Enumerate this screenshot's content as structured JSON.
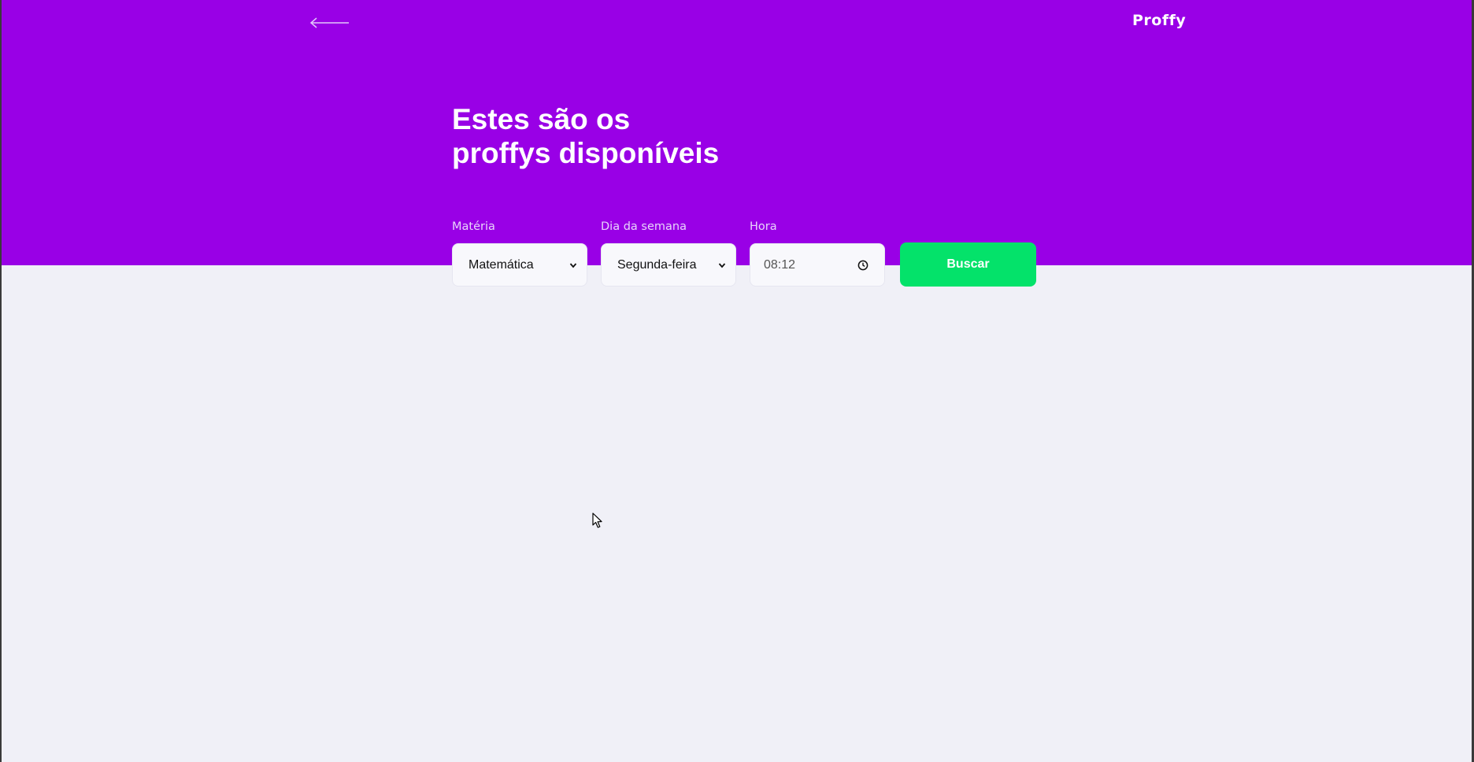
{
  "header": {
    "logo": "Proffy",
    "title_line1": "Estes são os",
    "title_line2": "proffys disponíveis",
    "back_icon": "arrow-left-icon"
  },
  "filters": {
    "subject": {
      "label": "Matéria",
      "value": "Matemática"
    },
    "weekday": {
      "label": "Dia da semana",
      "value": "Segunda-feira"
    },
    "time": {
      "label": "Hora",
      "value": "08:12",
      "icon": "clock-icon"
    }
  },
  "search_button": {
    "label": "Buscar"
  },
  "colors": {
    "header_bg": "#9900e6",
    "page_bg": "#f0f0f7",
    "button_bg": "#04e26a",
    "field_bg": "#f8f8fc"
  }
}
